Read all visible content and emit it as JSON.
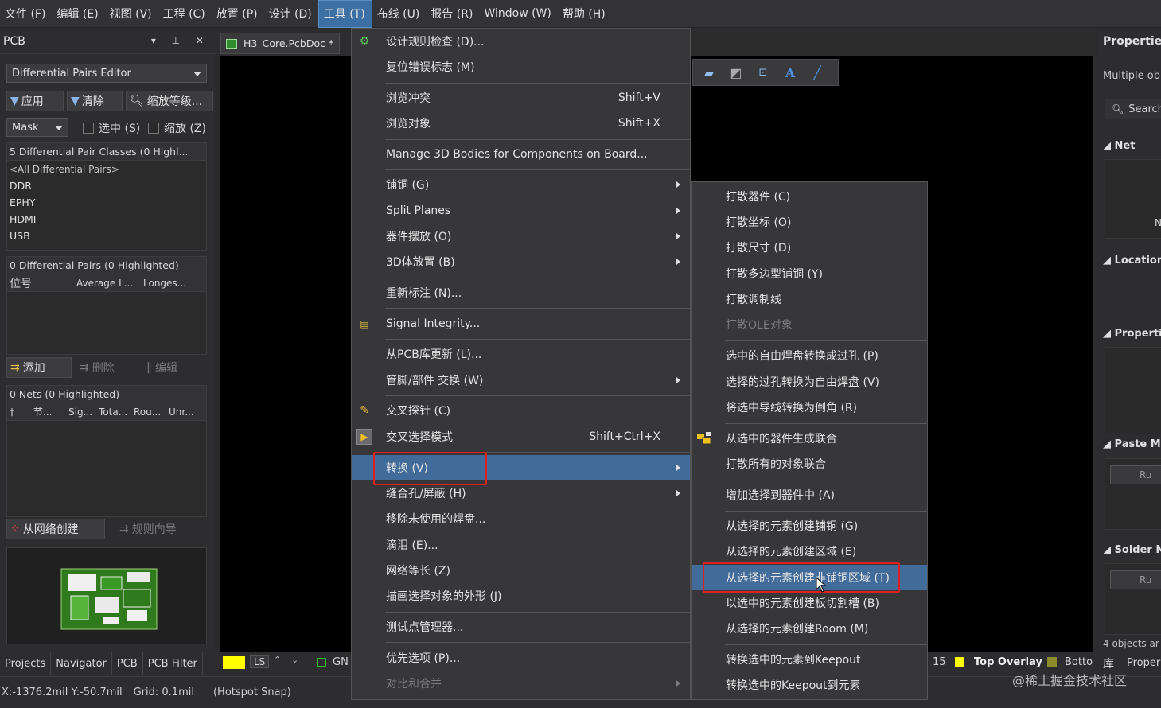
{
  "menubar": {
    "items": [
      "文件 (F)",
      "编辑 (E)",
      "视图 (V)",
      "工程 (C)",
      "放置 (P)",
      "设计 (D)",
      "工具 (T)",
      "布线 (U)",
      "报告 (R)",
      "Window (W)",
      "帮助 (H)"
    ]
  },
  "left_panel": {
    "title": "PCB",
    "title_icons": "▾ ⊥ ✕",
    "mode_combo": "Differential Pairs Editor",
    "buttons": {
      "apply": "应用",
      "clear": "清除",
      "zoom": "缩放等级..."
    },
    "mask_combo": "Mask",
    "checkbox_select": "选中 (S)",
    "checkbox_zoom": "缩放 (Z)",
    "classes_header": "5 Differential Pair Classes (0 Highl...",
    "classes": [
      "<All Differential Pairs>",
      "DDR",
      "EPHY",
      "HDMI",
      "USB"
    ],
    "pairs_header": "0 Differential Pairs (0 Highlighted)",
    "pairs_columns": [
      "位号",
      "Average L...",
      "Longes..."
    ],
    "pair_buttons": {
      "add": "添加",
      "delete": "删除",
      "edit": "编辑"
    },
    "nets_header": "0 Nets (0 Highlighted)",
    "nets_columns": [
      "‡",
      "节...",
      "Sig...",
      "Tota...",
      "Rou...",
      "Unr..."
    ],
    "bottom_buttons": {
      "from_net": "从网络创建",
      "rule_wizard": "规则向导"
    }
  },
  "doc_tab": {
    "label": "H3_Core.PcbDoc *"
  },
  "tools_menu": {
    "items": [
      {
        "label": "设计规则检查 (D)...",
        "shortcut": "",
        "submenu": false
      },
      {
        "label": "复位错误标志 (M)",
        "shortcut": "",
        "submenu": false
      },
      {
        "label": "浏览冲突",
        "shortcut": "Shift+V",
        "submenu": false
      },
      {
        "label": "浏览对象",
        "shortcut": "Shift+X",
        "submenu": false
      },
      {
        "label": "Manage 3D Bodies for Components on Board...",
        "shortcut": "",
        "submenu": false
      },
      {
        "label": "铺铜 (G)",
        "shortcut": "",
        "submenu": true
      },
      {
        "label": "Split Planes",
        "shortcut": "",
        "submenu": true
      },
      {
        "label": "器件摆放 (O)",
        "shortcut": "",
        "submenu": true
      },
      {
        "label": "3D体放置 (B)",
        "shortcut": "",
        "submenu": true
      },
      {
        "label": "重新标注 (N)...",
        "shortcut": "",
        "submenu": false
      },
      {
        "label": "Signal Integrity...",
        "shortcut": "",
        "submenu": false
      },
      {
        "label": "从PCB库更新 (L)...",
        "shortcut": "",
        "submenu": false
      },
      {
        "label": "管脚/部件 交换 (W)",
        "shortcut": "",
        "submenu": true
      },
      {
        "label": "交叉探针 (C)",
        "shortcut": "",
        "submenu": false
      },
      {
        "label": "交叉选择模式",
        "shortcut": "Shift+Ctrl+X",
        "submenu": false
      },
      {
        "label": "转换 (V)",
        "shortcut": "",
        "submenu": true
      },
      {
        "label": "缝合孔/屏蔽 (H)",
        "shortcut": "",
        "submenu": true
      },
      {
        "label": "移除未使用的焊盘...",
        "shortcut": "",
        "submenu": false
      },
      {
        "label": "滴泪 (E)...",
        "shortcut": "",
        "submenu": false
      },
      {
        "label": "网络等长 (Z)",
        "shortcut": "",
        "submenu": false
      },
      {
        "label": "描画选择对象的外形 (J)",
        "shortcut": "",
        "submenu": false
      },
      {
        "label": "测试点管理器...",
        "shortcut": "",
        "submenu": false
      },
      {
        "label": "优先选项 (P)...",
        "shortcut": "",
        "submenu": false
      },
      {
        "label": "对比和合并",
        "shortcut": "",
        "submenu": true
      }
    ]
  },
  "convert_submenu": {
    "items": [
      "打散器件 (C)",
      "打散坐标 (O)",
      "打散尺寸 (D)",
      "打散多边型铺铜 (Y)",
      "打散调制线",
      "打散OLE对象",
      "选中的自由焊盘转换成过孔 (P)",
      "选择的过孔转换为自由焊盘 (V)",
      "将选中导线转换为倒角 (R)",
      "从选中的器件生成联合",
      "打散所有的对象联合",
      "增加选择到器件中 (A)",
      "从选择的元素创建铺铜 (G)",
      "从选择的元素创建区域 (E)",
      "从选择的元素创建非铺铜区域 (T)",
      "以选中的元素创建板切割槽 (B)",
      "从选择的元素创建Room (M)",
      "转换选中的元素到Keepout",
      "转换选中的Keepout到元素"
    ]
  },
  "right_panel": {
    "title": "Properties",
    "subtitle": "Multiple ob",
    "search": "Search",
    "sections": [
      "Net",
      "Location",
      "Properties",
      "Paste Mas",
      "Solder Ma"
    ],
    "net_value": "Ne",
    "button_stub": "Ru",
    "footer": "4 objects ar"
  },
  "layer_bar": {
    "ls": "LS",
    "gnd": "GN",
    "num": "15",
    "top_overlay": "Top Overlay",
    "bottom": "Botto",
    "lib": "库",
    "proper": "Proper"
  },
  "bottom_tabs": [
    "Projects",
    "Navigator",
    "PCB",
    "PCB Filter"
  ],
  "status": {
    "coords": "X:-1376.2mil Y:-50.7mil",
    "grid": "Grid: 0.1mil",
    "snap": "(Hotspot Snap)"
  },
  "watermark": "@稀土掘金技术社区",
  "colors": {
    "highlight": "#416c9a",
    "annotation": "#e02020",
    "overlay_yellow": "#ffff00",
    "green_layer": "#2db82d"
  }
}
